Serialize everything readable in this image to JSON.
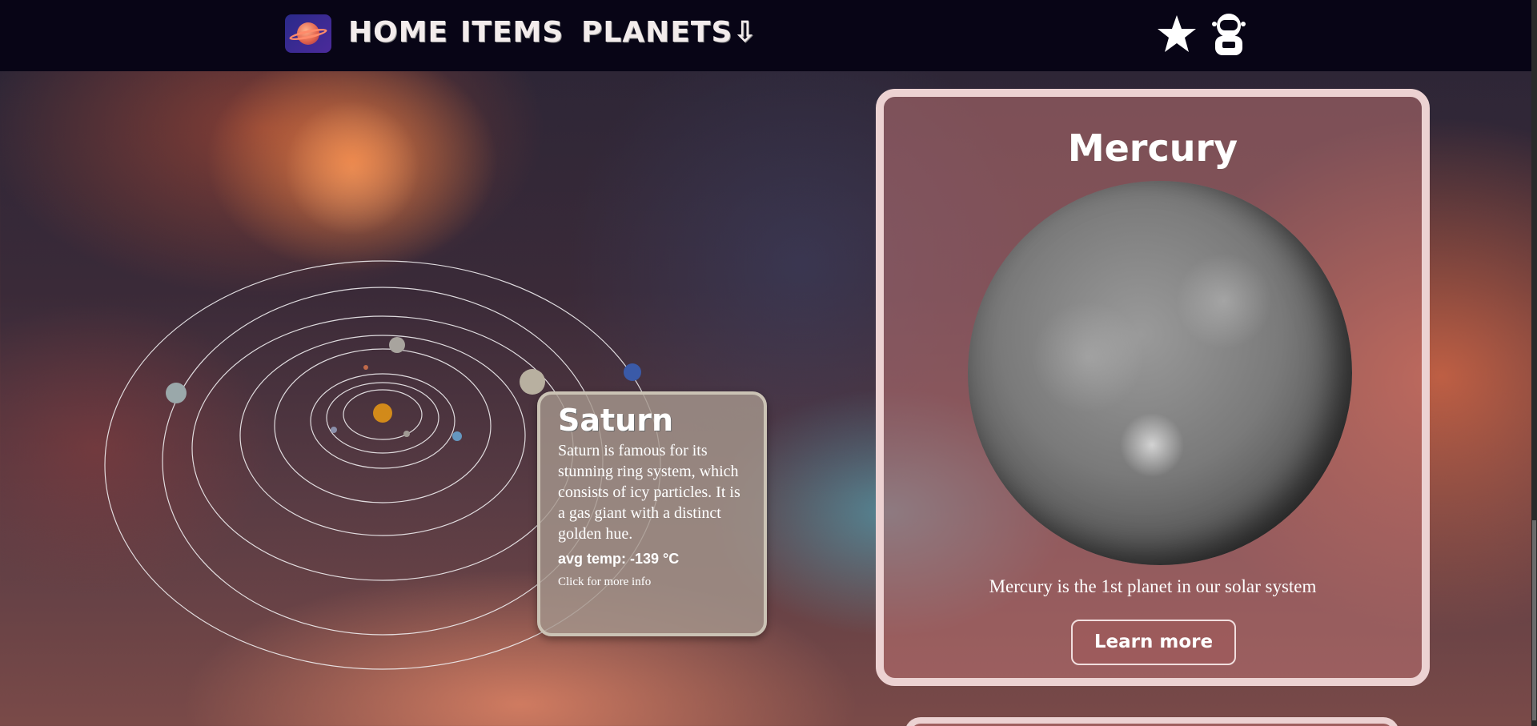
{
  "navbar": {
    "home_label": "HOME",
    "items_label": "ITEMS",
    "planets_label": "PLANETS⇩",
    "logo_icon": "planet-logo-icon",
    "favorites_icon": "star-icon",
    "profile_icon": "astronaut-icon"
  },
  "tooltip": {
    "title": "Saturn",
    "description": "Saturn is famous for its stunning ring system, which consists of icy particles. It is a gas giant with a distinct golden hue.",
    "temp": "avg temp: -139 °C",
    "more": "Click for more info"
  },
  "card": {
    "title": "Mercury",
    "subtitle": "Mercury is the 1st planet in our solar system",
    "button_label": "Learn more"
  },
  "colors": {
    "navbar_bg": "#080516",
    "card_border": "#ecd2d2",
    "tooltip_border": "#cbc3b5"
  }
}
